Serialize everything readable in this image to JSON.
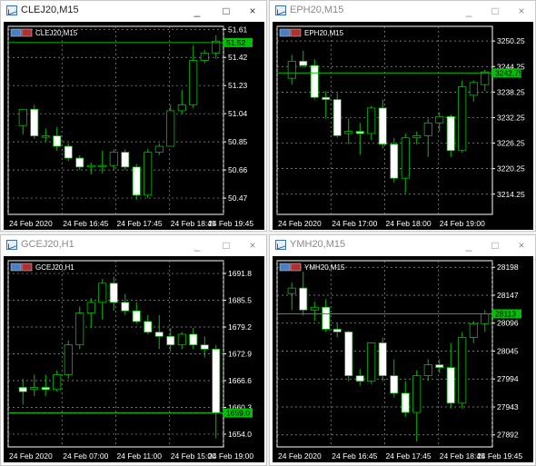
{
  "colors": {
    "background": "#000000",
    "grid": "#9a9a9a",
    "axis": "#ffffff",
    "bull": "#000000",
    "bear": "#ffffff",
    "wick": "#00c000",
    "candle_outline": "#00c000",
    "price_line": "#00c000",
    "price_label_bg": "#00c000"
  },
  "windows": [
    {
      "title": "CLEJ20,M15",
      "symbol_label": "CLEJ20,M15",
      "active": true,
      "buttons": [
        "_",
        "□",
        "×"
      ],
      "current_price": "51.52",
      "chart_data": {
        "type": "candlestick",
        "ylim": [
          50.36,
          51.63
        ],
        "price_ticks": [
          "51.61",
          "51.42",
          "51.23",
          "51.04",
          "50.85",
          "50.66",
          "50.47"
        ],
        "time_labels": [
          "24 Feb 2020",
          "24 Feb 16:45",
          "24 Feb 17:45",
          "24 Feb 18:45",
          "24 Feb 19:45"
        ],
        "current_price": 51.52,
        "candles": [
          {
            "o": 50.96,
            "h": 51.06,
            "l": 50.9,
            "c": 51.07
          },
          {
            "o": 51.07,
            "h": 51.1,
            "l": 50.87,
            "c": 50.89
          },
          {
            "o": 50.89,
            "h": 50.94,
            "l": 50.85,
            "c": 50.89
          },
          {
            "o": 50.89,
            "h": 50.95,
            "l": 50.79,
            "c": 50.82
          },
          {
            "o": 50.82,
            "h": 50.84,
            "l": 50.72,
            "c": 50.74
          },
          {
            "o": 50.74,
            "h": 50.76,
            "l": 50.66,
            "c": 50.68
          },
          {
            "o": 50.68,
            "h": 50.71,
            "l": 50.63,
            "c": 50.69
          },
          {
            "o": 50.69,
            "h": 50.79,
            "l": 50.64,
            "c": 50.69
          },
          {
            "o": 50.69,
            "h": 50.8,
            "l": 50.66,
            "c": 50.78
          },
          {
            "o": 50.78,
            "h": 50.8,
            "l": 50.66,
            "c": 50.68
          },
          {
            "o": 50.68,
            "h": 50.7,
            "l": 50.46,
            "c": 50.49
          },
          {
            "o": 50.49,
            "h": 50.8,
            "l": 50.47,
            "c": 50.78
          },
          {
            "o": 50.78,
            "h": 50.84,
            "l": 50.76,
            "c": 50.82
          },
          {
            "o": 50.82,
            "h": 51.1,
            "l": 50.82,
            "c": 51.06
          },
          {
            "o": 51.06,
            "h": 51.2,
            "l": 51.04,
            "c": 51.1
          },
          {
            "o": 51.1,
            "h": 51.5,
            "l": 51.08,
            "c": 51.4
          },
          {
            "o": 51.4,
            "h": 51.47,
            "l": 51.38,
            "c": 51.45
          },
          {
            "o": 51.45,
            "h": 51.57,
            "l": 51.41,
            "c": 51.53
          }
        ]
      }
    },
    {
      "title": "EPH20,M15",
      "symbol_label": "EPH20,M15",
      "active": false,
      "buttons": [
        "_",
        "□",
        "×"
      ],
      "current_price": "3242.75",
      "chart_data": {
        "type": "candlestick",
        "ylim": [
          3209.5,
          3253.7
        ],
        "price_ticks": [
          "3250.25",
          "3244.25",
          "3238.25",
          "3232.25",
          "3226.25",
          "3220.25",
          "3214.25"
        ],
        "time_labels": [
          "24 Feb 2020",
          "24 Feb 17:00",
          "24 Feb 18:00",
          "24 Feb 19:00"
        ],
        "current_price": 3242.75,
        "candles": [
          {
            "o": 3241.5,
            "h": 3247.0,
            "l": 3240.0,
            "c": 3245.5
          },
          {
            "o": 3245.5,
            "h": 3248.0,
            "l": 3244.0,
            "c": 3244.5
          },
          {
            "o": 3244.5,
            "h": 3246.0,
            "l": 3236.5,
            "c": 3237.0
          },
          {
            "o": 3237.0,
            "h": 3238.5,
            "l": 3232.0,
            "c": 3236.5
          },
          {
            "o": 3236.5,
            "h": 3238.0,
            "l": 3227.5,
            "c": 3228.0
          },
          {
            "o": 3228.5,
            "h": 3232.0,
            "l": 3226.0,
            "c": 3229.0
          },
          {
            "o": 3229.0,
            "h": 3231.0,
            "l": 3223.5,
            "c": 3228.5
          },
          {
            "o": 3228.5,
            "h": 3235.0,
            "l": 3227.0,
            "c": 3234.5
          },
          {
            "o": 3234.5,
            "h": 3236.5,
            "l": 3225.0,
            "c": 3226.0
          },
          {
            "o": 3226.0,
            "h": 3227.5,
            "l": 3217.0,
            "c": 3218.0
          },
          {
            "o": 3218.0,
            "h": 3228.5,
            "l": 3214.5,
            "c": 3227.5
          },
          {
            "o": 3227.5,
            "h": 3229.0,
            "l": 3226.0,
            "c": 3228.0
          },
          {
            "o": 3228.0,
            "h": 3232.0,
            "l": 3223.0,
            "c": 3231.0
          },
          {
            "o": 3231.0,
            "h": 3233.5,
            "l": 3229.0,
            "c": 3232.5
          },
          {
            "o": 3232.5,
            "h": 3233.0,
            "l": 3223.0,
            "c": 3224.5
          },
          {
            "o": 3224.5,
            "h": 3241.0,
            "l": 3224.0,
            "c": 3239.5
          },
          {
            "o": 3237.5,
            "h": 3241.0,
            "l": 3236.0,
            "c": 3240.5
          },
          {
            "o": 3240.0,
            "h": 3243.5,
            "l": 3238.5,
            "c": 3243.0
          }
        ]
      }
    },
    {
      "title": "GCEJ20,H1",
      "symbol_label": "GCEJ20,H1",
      "active": false,
      "buttons": [
        "_",
        "□",
        "×"
      ],
      "current_price": "1659.0",
      "chart_data": {
        "type": "candlestick",
        "ylim": [
          1651.0,
          1694.8
        ],
        "price_ticks": [
          "1691.8",
          "1685.5",
          "1679.2",
          "1672.9",
          "1666.6",
          "1660.3",
          "1654.0"
        ],
        "time_labels": [
          "24 Feb 2020",
          "24 Feb 07:00",
          "24 Feb 11:00",
          "24 Feb 15:00",
          "24 Feb 19:00"
        ],
        "current_price": 1659.0,
        "candles": [
          {
            "o": 1665.0,
            "h": 1667.0,
            "l": 1661.0,
            "c": 1664.0
          },
          {
            "o": 1664.5,
            "h": 1668.0,
            "l": 1663.0,
            "c": 1665.0
          },
          {
            "o": 1665.0,
            "h": 1668.0,
            "l": 1663.0,
            "c": 1664.5
          },
          {
            "o": 1664.5,
            "h": 1669.0,
            "l": 1664.0,
            "c": 1668.0
          },
          {
            "o": 1668.0,
            "h": 1676.0,
            "l": 1667.0,
            "c": 1675.0
          },
          {
            "o": 1675.0,
            "h": 1684.0,
            "l": 1674.0,
            "c": 1682.5
          },
          {
            "o": 1682.5,
            "h": 1686.0,
            "l": 1679.0,
            "c": 1685.0
          },
          {
            "o": 1685.0,
            "h": 1690.5,
            "l": 1681.0,
            "c": 1689.5
          },
          {
            "o": 1689.5,
            "h": 1691.0,
            "l": 1683.0,
            "c": 1685.0
          },
          {
            "o": 1685.0,
            "h": 1687.0,
            "l": 1682.0,
            "c": 1683.0
          },
          {
            "o": 1683.0,
            "h": 1685.0,
            "l": 1680.0,
            "c": 1680.5
          },
          {
            "o": 1680.5,
            "h": 1682.0,
            "l": 1677.5,
            "c": 1678.0
          },
          {
            "o": 1678.0,
            "h": 1682.0,
            "l": 1674.0,
            "c": 1677.0
          },
          {
            "o": 1677.0,
            "h": 1679.0,
            "l": 1673.5,
            "c": 1675.0
          },
          {
            "o": 1675.0,
            "h": 1678.0,
            "l": 1674.0,
            "c": 1677.5
          },
          {
            "o": 1677.5,
            "h": 1679.0,
            "l": 1674.0,
            "c": 1675.0
          },
          {
            "o": 1675.0,
            "h": 1677.0,
            "l": 1672.0,
            "c": 1674.0
          },
          {
            "o": 1674.0,
            "h": 1675.0,
            "l": 1653.0,
            "c": 1659.0
          }
        ]
      }
    },
    {
      "title": "YMH20,M15",
      "symbol_label": "YMH20,M15",
      "active": false,
      "buttons": [
        "_",
        "□",
        "×"
      ],
      "current_price": "28113",
      "chart_data": {
        "type": "candlestick",
        "ylim": [
          27870,
          28210
        ],
        "price_ticks": [
          "28198",
          "28147",
          "28096",
          "28045",
          "27994",
          "27943",
          "27892"
        ],
        "time_labels": [
          "24 Feb 2020",
          "24 Feb 16:45",
          "24 Feb 17:45",
          "24 Feb 18:45",
          "24 Feb 19:45"
        ],
        "current_price": 28113,
        "candles": [
          {
            "o": 28150,
            "h": 28170,
            "l": 28120,
            "c": 28160
          },
          {
            "o": 28160,
            "h": 28190,
            "l": 28110,
            "c": 28120
          },
          {
            "o": 28120,
            "h": 28135,
            "l": 28100,
            "c": 28125
          },
          {
            "o": 28125,
            "h": 28140,
            "l": 28080,
            "c": 28085
          },
          {
            "o": 28085,
            "h": 28095,
            "l": 28070,
            "c": 28080
          },
          {
            "o": 28080,
            "h": 28082,
            "l": 27990,
            "c": 28000
          },
          {
            "o": 28000,
            "h": 28012,
            "l": 27982,
            "c": 27990
          },
          {
            "o": 27990,
            "h": 28020,
            "l": 27985,
            "c": 28060
          },
          {
            "o": 28060,
            "h": 28070,
            "l": 27990,
            "c": 28000
          },
          {
            "o": 28000,
            "h": 28030,
            "l": 27960,
            "c": 27968
          },
          {
            "o": 27968,
            "h": 27990,
            "l": 27925,
            "c": 27933
          },
          {
            "o": 27933,
            "h": 28010,
            "l": 27880,
            "c": 28000
          },
          {
            "o": 28000,
            "h": 28030,
            "l": 27990,
            "c": 28020
          },
          {
            "o": 28020,
            "h": 28030,
            "l": 28005,
            "c": 28015
          },
          {
            "o": 28015,
            "h": 28060,
            "l": 27940,
            "c": 27950
          },
          {
            "o": 27950,
            "h": 28080,
            "l": 27940,
            "c": 28070
          },
          {
            "o": 28070,
            "h": 28100,
            "l": 28060,
            "c": 28095
          },
          {
            "o": 28095,
            "h": 28120,
            "l": 28080,
            "c": 28113
          }
        ]
      }
    }
  ]
}
